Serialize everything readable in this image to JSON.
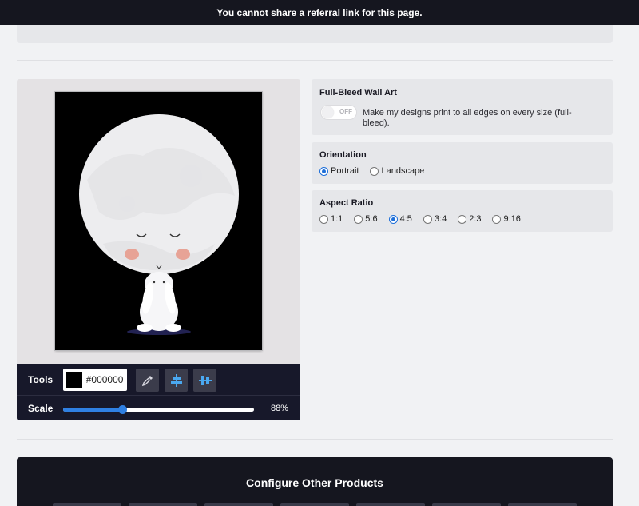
{
  "banner": {
    "text": "You cannot share a referral link for this page."
  },
  "tools": {
    "tools_label": "Tools",
    "color_value": "#000000",
    "scale_label": "Scale",
    "scale_percent": "88%",
    "scale_fraction": 0.31,
    "buttons": [
      "eyedropper-icon",
      "align-vertical-center-icon",
      "align-horizontal-center-icon"
    ]
  },
  "fullbleed": {
    "title": "Full-Bleed Wall Art",
    "toggle_label": "OFF",
    "description": "Make my designs print to all edges on every size (full-bleed)."
  },
  "orientation": {
    "title": "Orientation",
    "options": [
      "Portrait",
      "Landscape"
    ],
    "selected": "Portrait"
  },
  "aspect_ratio": {
    "title": "Aspect Ratio",
    "options": [
      "1:1",
      "5:6",
      "4:5",
      "3:4",
      "2:3",
      "9:16"
    ],
    "selected": "4:5"
  },
  "configure": {
    "title": "Configure Other Products"
  },
  "colors": {
    "accent": "#2f80e3",
    "dark": "#15161f",
    "panel": "#e6e7ea"
  }
}
